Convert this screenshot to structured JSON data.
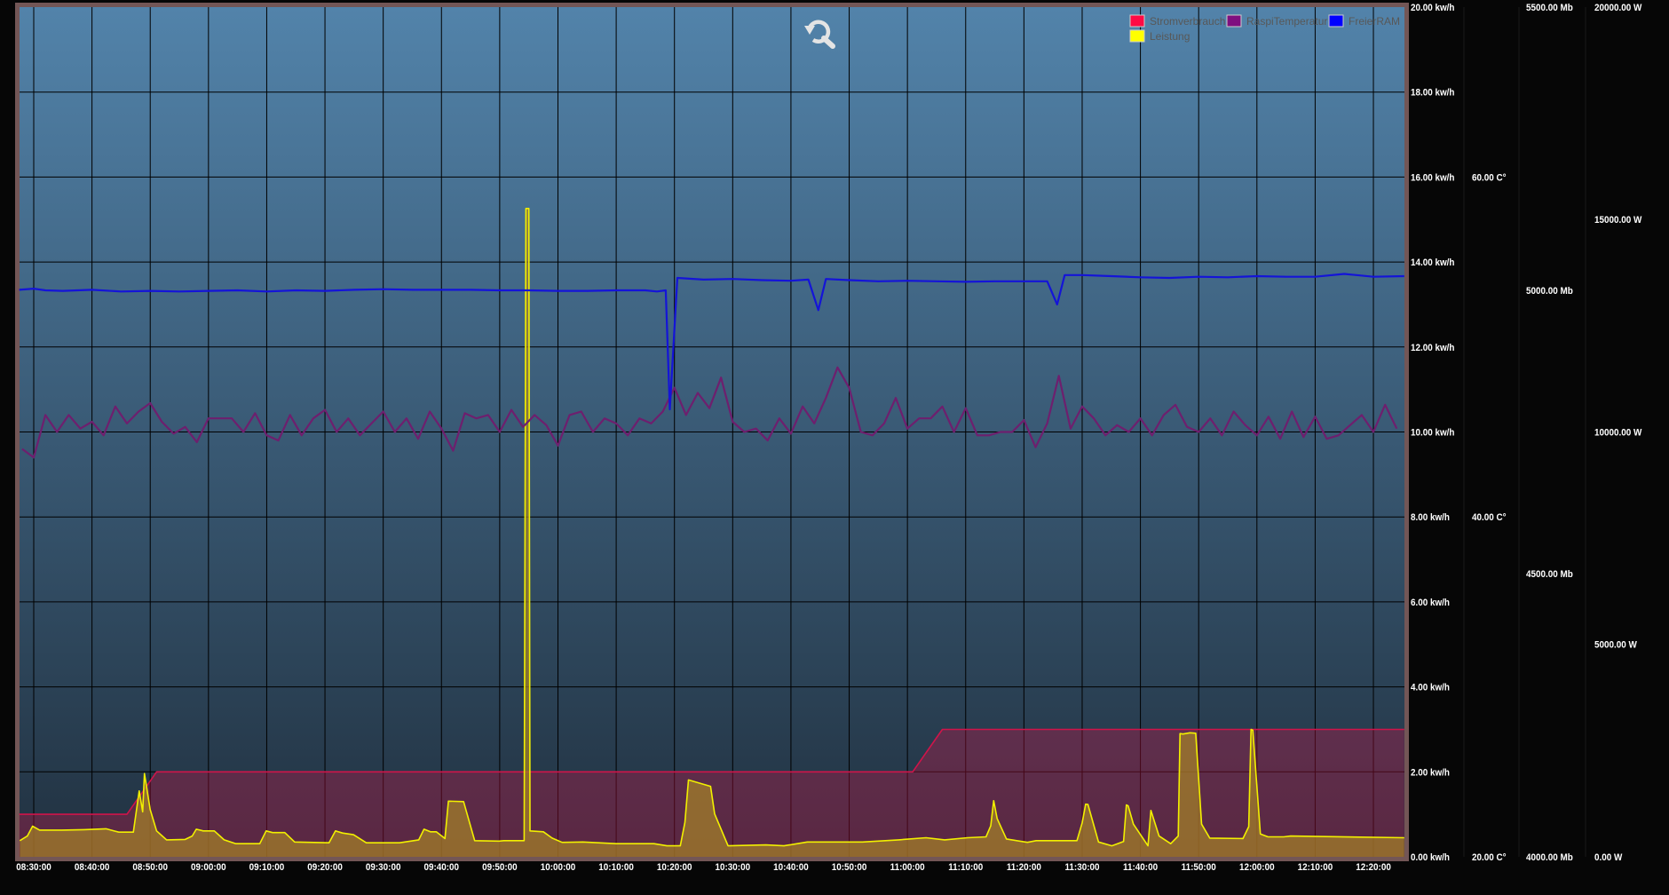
{
  "chart_data": {
    "type": "line",
    "title": "",
    "legend": {
      "placement": "top-right",
      "entries": [
        {
          "name": "Stromverbrauch",
          "color": "#ff0a45"
        },
        {
          "name": "RaspiTemperatur",
          "color": "#7f0f7f"
        },
        {
          "name": "FreierRAM",
          "color": "#0000ff"
        },
        {
          "name": "Leistung",
          "color": "#ffff00"
        }
      ]
    },
    "x_axis": {
      "unit": "minutes since 08:30:00",
      "range": [
        -2.5,
        235.3
      ],
      "tick_values": [
        0,
        10,
        20,
        30,
        40,
        50,
        60,
        70,
        80,
        90,
        100,
        110,
        120,
        130,
        140,
        150,
        160,
        170,
        180,
        190,
        200,
        210,
        220,
        230
      ],
      "tick_labels": [
        "08:30:00",
        "08:40:00",
        "08:50:00",
        "09:00:00",
        "09:10:00",
        "09:20:00",
        "09:30:00",
        "09:40:00",
        "09:50:00",
        "10:00:00",
        "10:10:00",
        "10:20:00",
        "10:30:00",
        "10:40:00",
        "10:50:00",
        "11:00:00",
        "11:10:00",
        "11:20:00",
        "11:30:00",
        "11:40:00",
        "11:50:00",
        "12:00:00",
        "12:10:00",
        "12:20:00"
      ],
      "grid": true
    },
    "y_axes": [
      {
        "id": "kwh",
        "range": [
          0,
          20
        ],
        "grid": true,
        "tick_values": [
          0,
          2,
          4,
          6,
          8,
          10,
          12,
          14,
          16,
          18,
          20
        ],
        "tick_labels": [
          "0.00 kw/h",
          "2.00 kw/h",
          "4.00 kw/h",
          "6.00 kw/h",
          "8.00 kw/h",
          "10.00 kw/h",
          "12.00 kw/h",
          "14.00 kw/h",
          "16.00 kw/h",
          "18.00 kw/h",
          "20.00 kw/h"
        ]
      },
      {
        "id": "temp",
        "range": [
          20,
          70
        ],
        "tick_values": [
          20,
          40,
          60
        ],
        "tick_labels": [
          "20.00 C°",
          "40.00 C°",
          "60.00 C°"
        ]
      },
      {
        "id": "ram",
        "range": [
          4000,
          5500
        ],
        "tick_values": [
          4000,
          4500,
          5000,
          5500
        ],
        "tick_labels": [
          "4000.00 Mb",
          "4500.00 Mb",
          "5000.00 Mb",
          "5500.00 Mb"
        ]
      },
      {
        "id": "watt",
        "range": [
          0,
          20000
        ],
        "tick_values": [
          0,
          5000,
          10000,
          15000,
          20000
        ],
        "tick_labels": [
          "0.00 W",
          "5000.00 W",
          "10000.00 W",
          "15000.00 W",
          "20000.00 W"
        ]
      }
    ],
    "series": [
      {
        "name": "Stromverbrauch",
        "axis": "kwh",
        "color": "#d0144a",
        "fill": "rgba(210,20,70,0.32)",
        "points": [
          [
            -2.5,
            1
          ],
          [
            16,
            1
          ],
          [
            21.1,
            2
          ],
          [
            150.9,
            2
          ],
          [
            156,
            3
          ],
          [
            235.3,
            3
          ]
        ]
      },
      {
        "name": "Leistung",
        "axis": "watt",
        "color": "#f2f000",
        "fill": "rgba(165,130,40,0.72)",
        "points": [
          [
            -2.4,
            380
          ],
          [
            -1.1,
            490
          ],
          [
            -0.2,
            720
          ],
          [
            1.0,
            630
          ],
          [
            4.8,
            630
          ],
          [
            8.6,
            640
          ],
          [
            12.4,
            660
          ],
          [
            14.6,
            580
          ],
          [
            17.1,
            580
          ],
          [
            18.1,
            1550
          ],
          [
            18.7,
            1060
          ],
          [
            19.0,
            1960
          ],
          [
            20.0,
            1110
          ],
          [
            21.1,
            610
          ],
          [
            22.8,
            400
          ],
          [
            26.0,
            410
          ],
          [
            27.2,
            490
          ],
          [
            27.9,
            650
          ],
          [
            29.1,
            610
          ],
          [
            31.0,
            610
          ],
          [
            32.7,
            400
          ],
          [
            34.7,
            310
          ],
          [
            38.8,
            310
          ],
          [
            39.9,
            610
          ],
          [
            41.0,
            570
          ],
          [
            43.1,
            570
          ],
          [
            44.8,
            350
          ],
          [
            50.7,
            330
          ],
          [
            51.8,
            610
          ],
          [
            53.0,
            560
          ],
          [
            54.9,
            520
          ],
          [
            57.1,
            330
          ],
          [
            62.8,
            330
          ],
          [
            66.1,
            400
          ],
          [
            67.0,
            650
          ],
          [
            68.1,
            590
          ],
          [
            69.1,
            590
          ],
          [
            70.6,
            430
          ],
          [
            71.2,
            1310
          ],
          [
            73.8,
            1300
          ],
          [
            75.7,
            380
          ],
          [
            79.9,
            370
          ],
          [
            80.7,
            380
          ],
          [
            84.2,
            380
          ],
          [
            84.5,
            15260
          ],
          [
            85.0,
            15260
          ],
          [
            85.2,
            610
          ],
          [
            87.5,
            590
          ],
          [
            89.0,
            440
          ],
          [
            90.7,
            340
          ],
          [
            94.3,
            350
          ],
          [
            100.0,
            310
          ],
          [
            106.5,
            310
          ],
          [
            108.7,
            260
          ],
          [
            111.0,
            260
          ],
          [
            111.8,
            810
          ],
          [
            112.4,
            1810
          ],
          [
            116.2,
            1660
          ],
          [
            116.9,
            1010
          ],
          [
            119.2,
            260
          ],
          [
            125.7,
            280
          ],
          [
            128.8,
            260
          ],
          [
            132.8,
            350
          ],
          [
            142.3,
            350
          ],
          [
            148.5,
            400
          ],
          [
            153.2,
            450
          ],
          [
            156.4,
            400
          ],
          [
            160.3,
            450
          ],
          [
            163.5,
            470
          ],
          [
            164.3,
            730
          ],
          [
            164.8,
            1320
          ],
          [
            165.4,
            900
          ],
          [
            167.0,
            420
          ],
          [
            170.6,
            340
          ],
          [
            172.1,
            380
          ],
          [
            179.1,
            380
          ],
          [
            180.0,
            800
          ],
          [
            180.6,
            1240
          ],
          [
            181.0,
            1230
          ],
          [
            182.8,
            350
          ],
          [
            185.1,
            260
          ],
          [
            187.1,
            360
          ],
          [
            187.6,
            1220
          ],
          [
            187.9,
            1200
          ],
          [
            188.8,
            770
          ],
          [
            191.3,
            260
          ],
          [
            191.8,
            1090
          ],
          [
            193.2,
            490
          ],
          [
            195.2,
            310
          ],
          [
            196.5,
            490
          ],
          [
            196.8,
            2900
          ],
          [
            197.3,
            2890
          ],
          [
            198.5,
            2920
          ],
          [
            199.5,
            2910
          ],
          [
            200.5,
            770
          ],
          [
            201.9,
            440
          ],
          [
            207.6,
            430
          ],
          [
            208.6,
            710
          ],
          [
            209.0,
            3000
          ],
          [
            209.3,
            2980
          ],
          [
            210.6,
            540
          ],
          [
            211.9,
            470
          ],
          [
            214.6,
            470
          ],
          [
            215.8,
            490
          ],
          [
            235.3,
            450
          ]
        ]
      },
      {
        "name": "RaspiTemperatur",
        "axis": "temp",
        "color": "#6e1f6e",
        "start": -2,
        "step": 2,
        "values": [
          44.0,
          43.5,
          46.0,
          45.0,
          46.0,
          45.2,
          45.6,
          44.8,
          46.5,
          45.5,
          46.2,
          46.7,
          45.6,
          44.9,
          45.3,
          44.4,
          45.8,
          45.8,
          45.8,
          45.0,
          46.1,
          44.8,
          44.5,
          46.0,
          44.8,
          45.8,
          46.3,
          45.0,
          45.8,
          44.8,
          45.5,
          46.2,
          45.0,
          45.8,
          44.6,
          46.2,
          45.2,
          43.9,
          46.1,
          45.8,
          46.0,
          45.0,
          46.3,
          45.3,
          46.0,
          45.4,
          44.2,
          46.0,
          46.2,
          45.0,
          45.8,
          45.5,
          44.8,
          45.8,
          45.5,
          46.2,
          47.6,
          46.0,
          47.3,
          46.4,
          48.2,
          45.6,
          45.0,
          45.2,
          44.5,
          45.8,
          44.9,
          46.5,
          45.5,
          47.0,
          48.8,
          47.6,
          45.0,
          44.8,
          45.5,
          47.0,
          45.2,
          45.8,
          45.8,
          46.5,
          45.0,
          46.4,
          44.8,
          44.8,
          45.0,
          45.0,
          45.7,
          44.1,
          45.5,
          48.3,
          45.2,
          46.5,
          45.8,
          44.8,
          45.4,
          45.0,
          45.8,
          44.8,
          46.0,
          46.6,
          45.3,
          45.0,
          45.8,
          44.8,
          46.2,
          45.4,
          44.8,
          45.9,
          44.6,
          46.2,
          44.7,
          45.9,
          44.6,
          44.8,
          45.4,
          46.0,
          45.0,
          46.6,
          45.2
        ]
      },
      {
        "name": "FreierRAM",
        "axis": "ram",
        "color": "#1414d8",
        "points": [
          [
            -2.5,
            5001
          ],
          [
            0,
            5003
          ],
          [
            2,
            5000
          ],
          [
            5,
            4999
          ],
          [
            10,
            5001
          ],
          [
            15,
            4998
          ],
          [
            20,
            4999
          ],
          [
            25,
            4998
          ],
          [
            30,
            4999
          ],
          [
            35,
            5000
          ],
          [
            40,
            4998
          ],
          [
            45,
            5000
          ],
          [
            50,
            4999
          ],
          [
            55,
            5001
          ],
          [
            60,
            5002
          ],
          [
            65,
            5001
          ],
          [
            70,
            5001
          ],
          [
            75,
            5001
          ],
          [
            80,
            5000
          ],
          [
            85,
            5000
          ],
          [
            90,
            4999
          ],
          [
            95,
            4999
          ],
          [
            100,
            5000
          ],
          [
            105,
            5000
          ],
          [
            107,
            4998
          ],
          [
            108.5,
            5000
          ],
          [
            109.2,
            4790
          ],
          [
            110.5,
            5022
          ],
          [
            112,
            5021
          ],
          [
            115,
            5019
          ],
          [
            120,
            5020
          ],
          [
            125,
            5018
          ],
          [
            130,
            5017
          ],
          [
            133,
            5019
          ],
          [
            134.7,
            4965
          ],
          [
            136,
            5020
          ],
          [
            140,
            5018
          ],
          [
            145,
            5016
          ],
          [
            150,
            5017
          ],
          [
            155,
            5016
          ],
          [
            160,
            5015
          ],
          [
            165,
            5016
          ],
          [
            170,
            5016
          ],
          [
            174,
            5016
          ],
          [
            175.7,
            4975
          ],
          [
            177,
            5027
          ],
          [
            180,
            5027
          ],
          [
            185,
            5025
          ],
          [
            190,
            5023
          ],
          [
            195,
            5022
          ],
          [
            200,
            5024
          ],
          [
            205,
            5023
          ],
          [
            210,
            5025
          ],
          [
            215,
            5024
          ],
          [
            220,
            5024
          ],
          [
            225,
            5029
          ],
          [
            230,
            5024
          ],
          [
            235.3,
            5025
          ]
        ]
      }
    ]
  },
  "toolbar": {
    "zoom_reset_icon": "zoom-reset-icon"
  }
}
